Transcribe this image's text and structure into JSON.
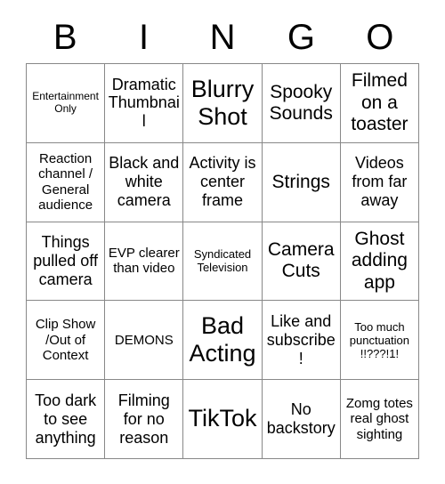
{
  "card": {
    "title": "BINGO",
    "headers": [
      "B",
      "I",
      "N",
      "G",
      "O"
    ],
    "rows": [
      [
        {
          "text": "Entertainment Only",
          "size": "fs-xxs"
        },
        {
          "text": "Dramatic Thumbnail",
          "size": "fs-md"
        },
        {
          "text": "Blurry Shot",
          "size": "fs-xl"
        },
        {
          "text": "Spooky Sounds",
          "size": "fs-lg"
        },
        {
          "text": "Filmed on a toaster",
          "size": "fs-lg"
        }
      ],
      [
        {
          "text": "Reaction channel / General audience",
          "size": "fs-sm"
        },
        {
          "text": "Black and white camera",
          "size": "fs-md"
        },
        {
          "text": "Activity is center frame",
          "size": "fs-md"
        },
        {
          "text": "Strings",
          "size": "fs-lg"
        },
        {
          "text": "Videos from far away",
          "size": "fs-md"
        }
      ],
      [
        {
          "text": "Things pulled off camera",
          "size": "fs-md"
        },
        {
          "text": "EVP clearer than video",
          "size": "fs-sm"
        },
        {
          "text": "Syndicated Television",
          "size": "fs-xs"
        },
        {
          "text": "Camera Cuts",
          "size": "fs-lg"
        },
        {
          "text": "Ghost adding app",
          "size": "fs-lg"
        }
      ],
      [
        {
          "text": "Clip Show /Out of Context",
          "size": "fs-sm"
        },
        {
          "text": "DEMONS",
          "size": "fs-sm"
        },
        {
          "text": "Bad Acting",
          "size": "fs-xl"
        },
        {
          "text": "Like and subscribe!",
          "size": "fs-md"
        },
        {
          "text": "Too much punctuation !!???!1!",
          "size": "fs-xs"
        }
      ],
      [
        {
          "text": "Too dark to see anything",
          "size": "fs-md"
        },
        {
          "text": "Filming for no reason",
          "size": "fs-md"
        },
        {
          "text": "TikTok",
          "size": "fs-xl"
        },
        {
          "text": "No backstory",
          "size": "fs-md"
        },
        {
          "text": "Zomg totes real ghost sighting",
          "size": "fs-sm"
        }
      ]
    ]
  },
  "colors": {
    "background": "#ffffff",
    "text": "#000000",
    "grid_line": "#888888"
  }
}
